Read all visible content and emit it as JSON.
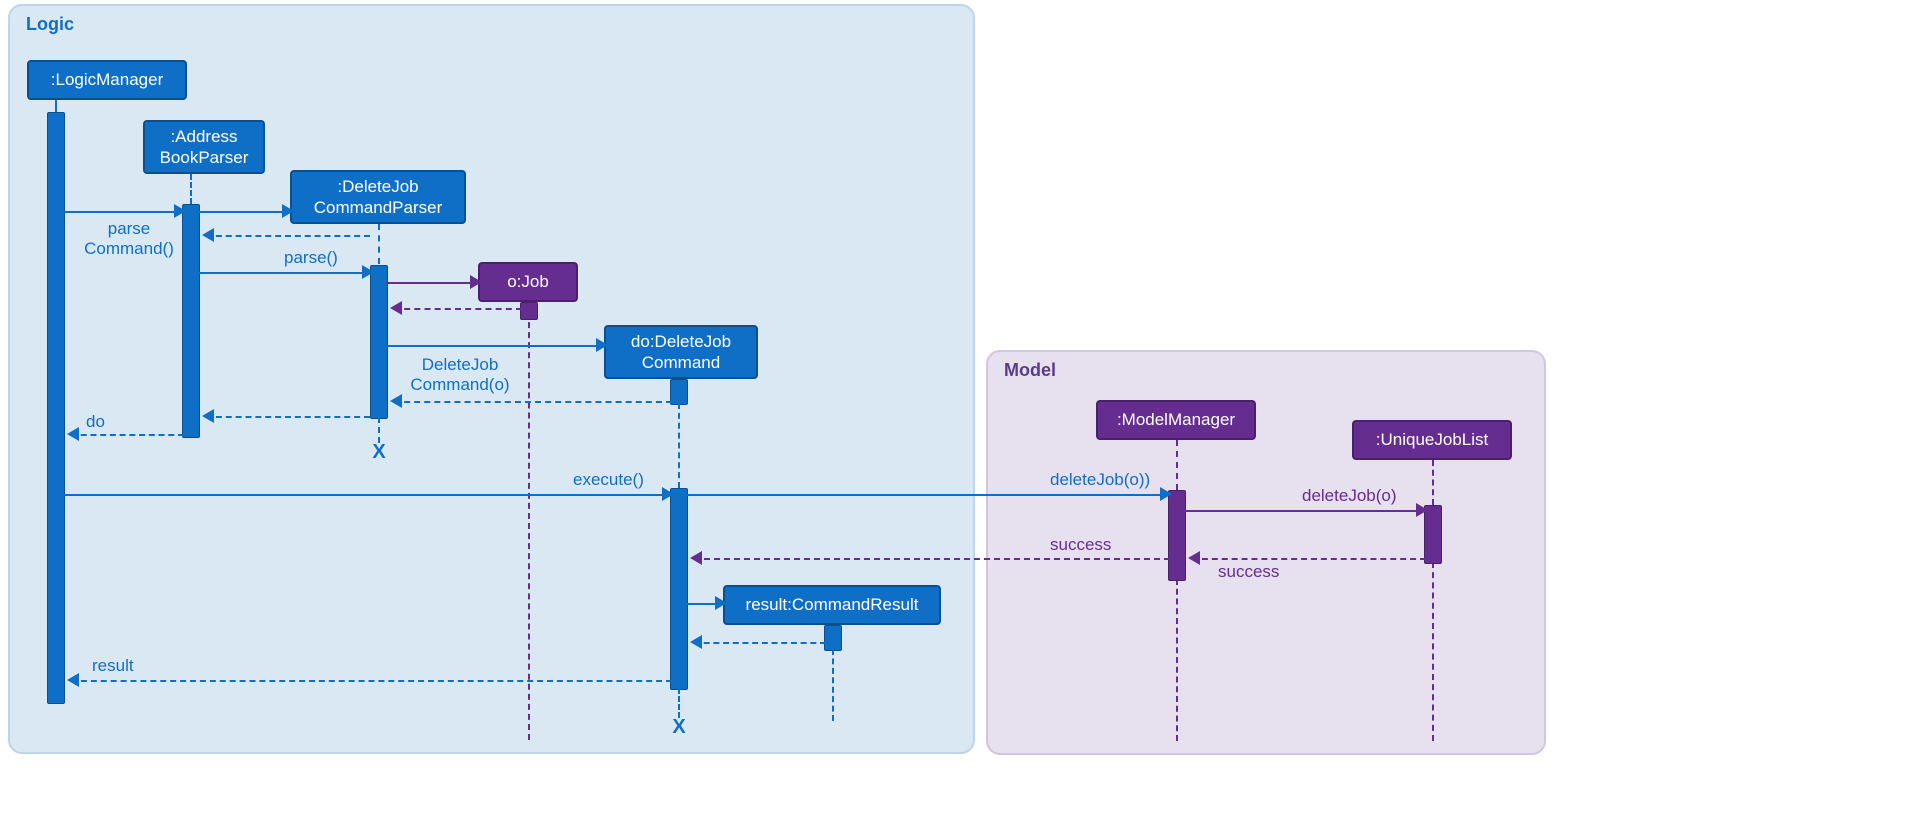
{
  "frames": {
    "logic": {
      "title": "Logic"
    },
    "model": {
      "title": "Model"
    }
  },
  "participants": {
    "logicManager": ":LogicManager",
    "addressBookParser": ":Address\nBookParser",
    "deleteJobCommandParser": ":DeleteJob\nCommandParser",
    "oJob": "o:Job",
    "deleteJobCommand": "do:DeleteJob\nCommand",
    "commandResult": "result:CommandResult",
    "modelManager": ":ModelManager",
    "uniqueJobList": ":UniqueJobList"
  },
  "messages": {
    "parseCommand": "parse\nCommand()",
    "parse": "parse()",
    "deleteJobCommandO": "DeleteJob\nCommand(o)",
    "doReturn": "do",
    "execute": "execute()",
    "deleteJobO1": "deleteJob(o))",
    "deleteJobO2": "deleteJob(o)",
    "success": "success",
    "result": "result",
    "destroy": "X"
  }
}
